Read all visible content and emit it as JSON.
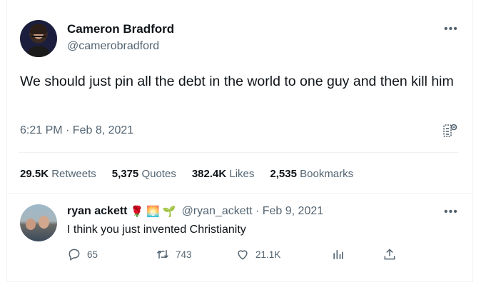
{
  "tweet": {
    "author": {
      "name": "Cameron Bradford",
      "handle": "@camerobradford"
    },
    "more_icon": "more-dots-icon",
    "text": "We should just pin all the debt in the world to one guy and then kill him",
    "timestamp": "6:21 PM · Feb 8, 2021",
    "analytics_icon": "analytics-icon",
    "stats": {
      "retweets_count": "29.5K",
      "retweets_label": "Retweets",
      "quotes_count": "5,375",
      "quotes_label": "Quotes",
      "likes_count": "382.4K",
      "likes_label": "Likes",
      "bookmarks_count": "2,535",
      "bookmarks_label": "Bookmarks"
    }
  },
  "reply": {
    "author": {
      "name": "ryan ackett",
      "handle": "@ryan_ackett · Feb 9, 2021"
    },
    "emojis": [
      "🌹",
      "🌅",
      "🌱"
    ],
    "text": "I think you just invented Christianity",
    "actions": {
      "replies": "65",
      "retweets": "743",
      "likes": "21.1K"
    },
    "icons": [
      "reply-icon",
      "retweet-icon",
      "like-icon",
      "views-icon",
      "share-icon"
    ],
    "colors": {
      "muted": "#536471",
      "text": "#0f1419",
      "border": "#eff3f4"
    }
  }
}
